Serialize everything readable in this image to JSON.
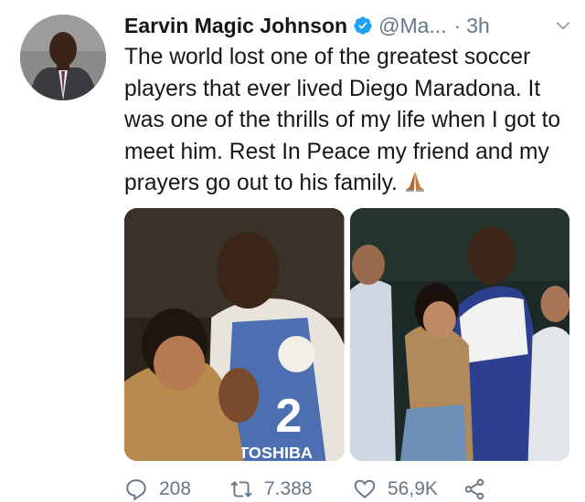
{
  "tweet": {
    "author_name": "Earvin Magic Johnson",
    "handle": "@Ma...",
    "separator": "·",
    "time": "3h",
    "text": "The world lost one of the greatest soccer players that ever lived Diego Maradona. It was one of the thrills of my life when I got to meet him. Rest In Peace my friend and my prayers go out to his family.",
    "emoji": "praying-hands-emoji",
    "photo_jersey_number": "2",
    "photo_jersey_text": "TOSHIBA"
  },
  "actions": {
    "replies": "208",
    "retweets": "7.388",
    "likes": "56,9K"
  },
  "icons": {
    "verified": "verified-badge-icon",
    "menu": "chevron-down-icon",
    "reply": "reply-icon",
    "retweet": "retweet-icon",
    "like": "heart-icon",
    "share": "share-icon"
  },
  "colors": {
    "verified": "#1da1f2",
    "secondary_text": "#657786",
    "primary_text": "#14171a"
  }
}
